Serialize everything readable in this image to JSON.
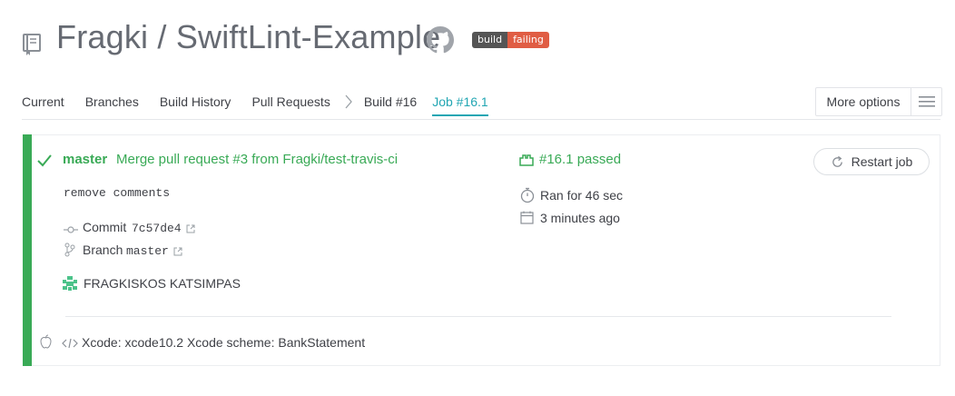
{
  "repo": {
    "title": "Fragki / SwiftLint-Example"
  },
  "badge": {
    "left": "build",
    "right": "failing"
  },
  "tabs": [
    {
      "label": "Current"
    },
    {
      "label": "Branches"
    },
    {
      "label": "Build History"
    },
    {
      "label": "Pull Requests"
    },
    {
      "label": "Build #16"
    },
    {
      "label": "Job #16.1"
    }
  ],
  "more_options": {
    "label": "More options"
  },
  "job": {
    "branch": "master",
    "commit_title": "Merge pull request #3 from Fragki/test-travis-ci",
    "commit_message": "remove comments",
    "commit_label": "Commit",
    "commit_sha": "7c57de4",
    "branch_label": "Branch",
    "branch_name": "master",
    "author": "FRAGKISKOS KATSIMPAS",
    "status": "#16.1 passed",
    "duration": "Ran for 46 sec",
    "finished": "3 minutes ago",
    "restart_label": "Restart job",
    "config": "Xcode: xcode10.2 Xcode scheme: BankStatement"
  },
  "colors": {
    "passed": "#39aa56",
    "active_tab": "#22a6b3",
    "badge_fail": "#e05d44"
  }
}
